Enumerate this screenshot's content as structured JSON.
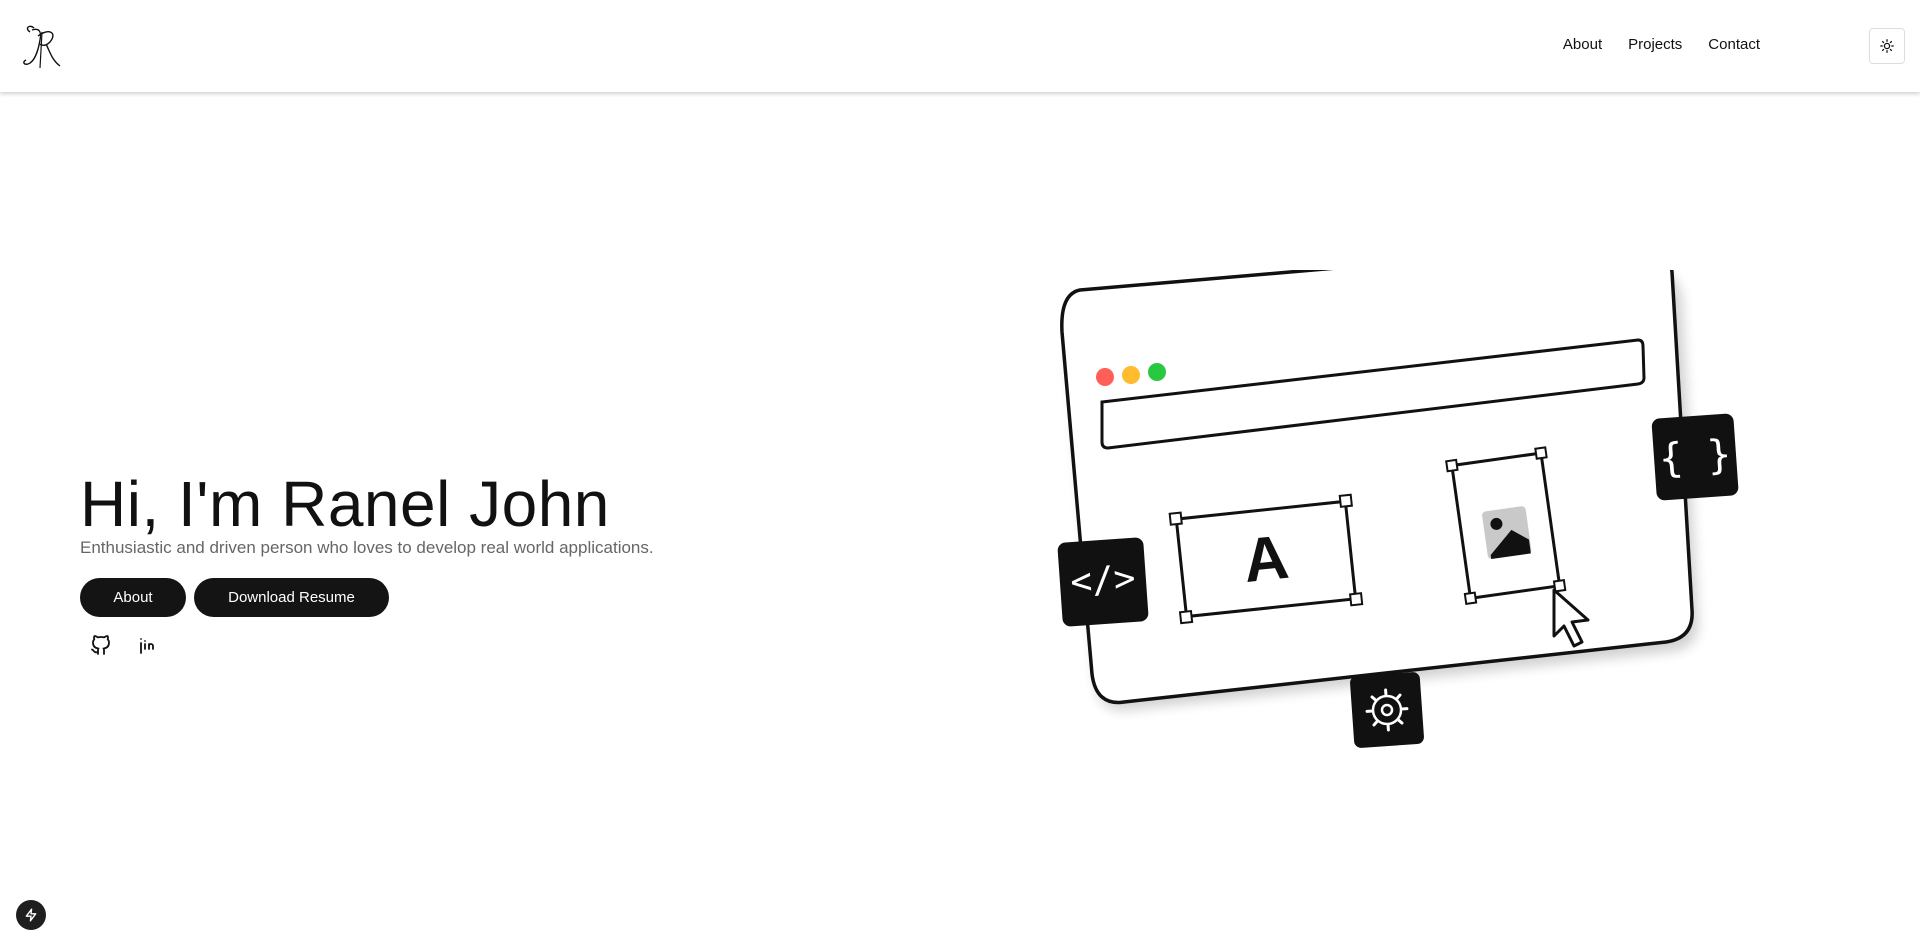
{
  "header": {
    "logo_text": "JR",
    "nav": [
      {
        "label": "About"
      },
      {
        "label": "Projects"
      },
      {
        "label": "Contact"
      }
    ],
    "theme_icon": "sun-icon"
  },
  "hero": {
    "title": "Hi, I'm Ranel John",
    "subtitle": "Enthusiastic and driven person who loves to develop real world applications.",
    "buttons": {
      "about": "About",
      "resume": "Download Resume"
    },
    "social_icons": [
      "github-icon",
      "linkedin-icon"
    ]
  },
  "illustration": {
    "text_box_letter": "A",
    "code_badge": "</>",
    "braces_badge": "{ }",
    "window_dots": [
      "#ff5f57",
      "#febc2e",
      "#28c840"
    ]
  },
  "footer": {
    "floating_icon": "bolt-icon"
  }
}
